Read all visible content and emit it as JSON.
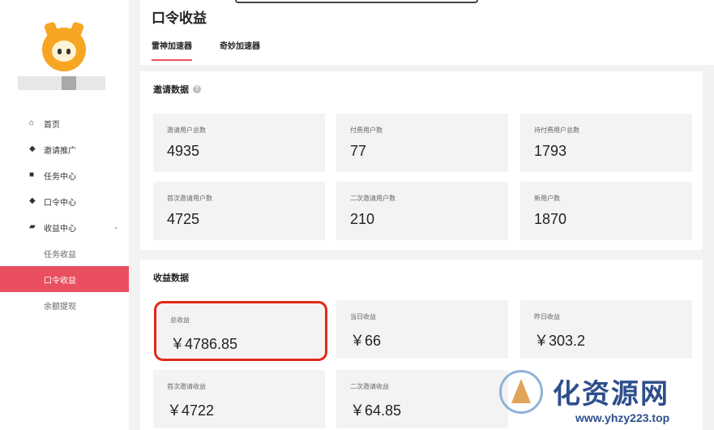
{
  "sidebar": {
    "nav": [
      {
        "label": "首页",
        "icon": "home-icon"
      },
      {
        "label": "邀请推广",
        "icon": "shield-icon"
      },
      {
        "label": "任务中心",
        "icon": "document-icon"
      },
      {
        "label": "口令中心",
        "icon": "shield-icon"
      },
      {
        "label": "收益中心",
        "icon": "wallet-icon"
      }
    ],
    "sub": [
      {
        "label": "任务收益"
      },
      {
        "label": "口令收益",
        "active": true
      },
      {
        "label": "余额提现"
      }
    ]
  },
  "header": {
    "title": "口令收益",
    "tabs": [
      {
        "label": "雷神加速器",
        "active": true
      },
      {
        "label": "奇妙加速器"
      }
    ]
  },
  "invite": {
    "title": "邀请数据",
    "cards": [
      {
        "label": "邀请用户总数",
        "value": "4935"
      },
      {
        "label": "付费用户数",
        "value": "77"
      },
      {
        "label": "待付费用户总数",
        "value": "1793"
      },
      {
        "label": "首次邀请用户数",
        "value": "4725"
      },
      {
        "label": "二次邀请用户数",
        "value": "210"
      },
      {
        "label": "新用户数",
        "value": "1870"
      }
    ]
  },
  "income": {
    "title": "收益数据",
    "cards": [
      {
        "label": "总收益",
        "value": "￥4786.85"
      },
      {
        "label": "当日收益",
        "value": "￥66"
      },
      {
        "label": "昨日收益",
        "value": "￥303.2"
      },
      {
        "label": "首次邀请收益",
        "value": "￥4722"
      },
      {
        "label": "二次邀请收益",
        "value": "￥64.85"
      }
    ]
  },
  "watermark": {
    "text": "化资源网",
    "url": "www.yhzy223.top"
  },
  "colors": {
    "accent": "#e94f5e",
    "highlight": "#e02a1a",
    "card_bg": "#f3f3f3"
  }
}
